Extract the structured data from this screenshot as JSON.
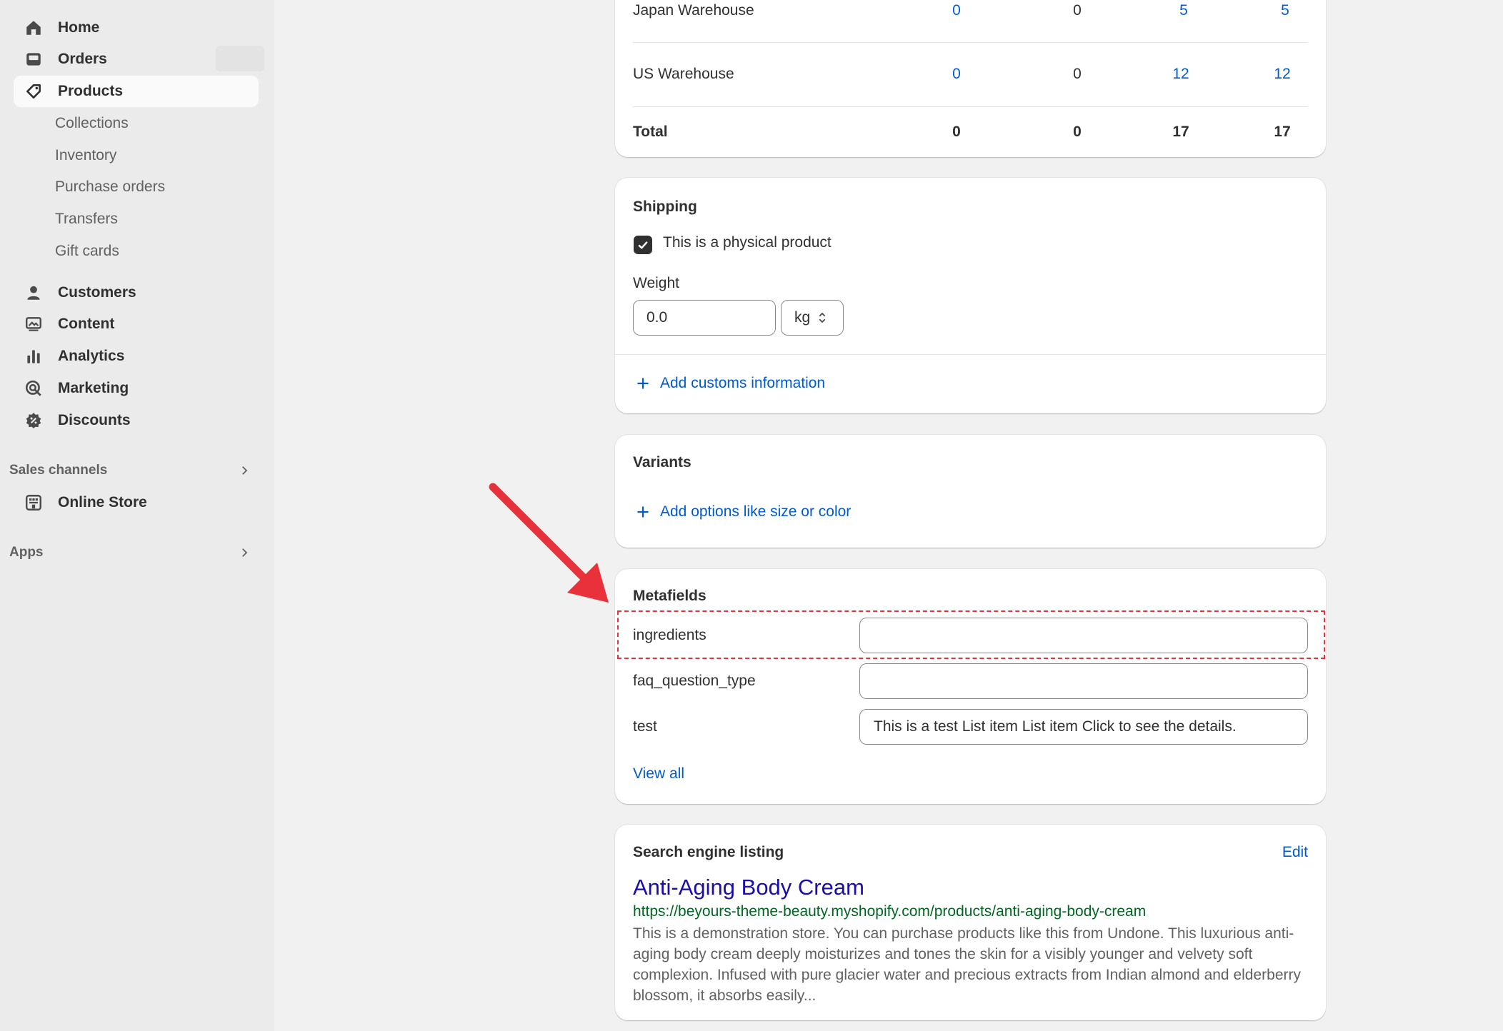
{
  "sidebar": {
    "items": [
      {
        "label": "Home",
        "icon": "home-icon"
      },
      {
        "label": "Orders",
        "icon": "orders-icon"
      },
      {
        "label": "Products",
        "icon": "tag-icon"
      }
    ],
    "product_subitems": [
      "Collections",
      "Inventory",
      "Purchase orders",
      "Transfers",
      "Gift cards"
    ],
    "items2": [
      {
        "label": "Customers",
        "icon": "person-icon"
      },
      {
        "label": "Content",
        "icon": "content-icon"
      },
      {
        "label": "Analytics",
        "icon": "analytics-icon"
      },
      {
        "label": "Marketing",
        "icon": "marketing-icon"
      },
      {
        "label": "Discounts",
        "icon": "discount-icon"
      }
    ],
    "sales_channels_label": "Sales channels",
    "online_store_label": "Online Store",
    "apps_label": "Apps"
  },
  "inventory": {
    "rows": [
      {
        "location": "Japan Warehouse",
        "unavailable": "0",
        "committed": "0",
        "available": "5",
        "on_hand": "5"
      },
      {
        "location": "US Warehouse",
        "unavailable": "0",
        "committed": "0",
        "available": "12",
        "on_hand": "12"
      }
    ],
    "total": {
      "location": "Total",
      "unavailable": "0",
      "committed": "0",
      "available": "17",
      "on_hand": "17"
    }
  },
  "shipping": {
    "title": "Shipping",
    "physical_label": "This is a physical product",
    "physical_checked": true,
    "weight_label": "Weight",
    "weight_value": "0.0",
    "weight_unit": "kg",
    "customs_link": "Add customs information"
  },
  "variants": {
    "title": "Variants",
    "add_options_link": "Add options like size or color"
  },
  "metafields": {
    "title": "Metafields",
    "fields": [
      {
        "label": "ingredients",
        "value": ""
      },
      {
        "label": "faq_question_type",
        "value": ""
      },
      {
        "label": "test",
        "value": "This is a test List item List item Click to see the details."
      }
    ],
    "view_all": "View all"
  },
  "seo": {
    "title": "Search engine listing",
    "edit_label": "Edit",
    "page_title": "Anti-Aging Body Cream",
    "url": "https://beyours-theme-beauty.myshopify.com/products/anti-aging-body-cream",
    "description": "This is a demonstration store. You can purchase products like this from Undone. This luxurious anti-aging body cream deeply moisturizes and tones the skin for a visibly younger and velvety soft complexion. Infused with pure glacier water and precious extracts from Indian almond and elderberry blossom, it absorbs easily..."
  },
  "colors": {
    "link": "#005bd3",
    "annotation": "#e8313a",
    "seo_title": "#1a0dab",
    "seo_url": "#006621"
  }
}
